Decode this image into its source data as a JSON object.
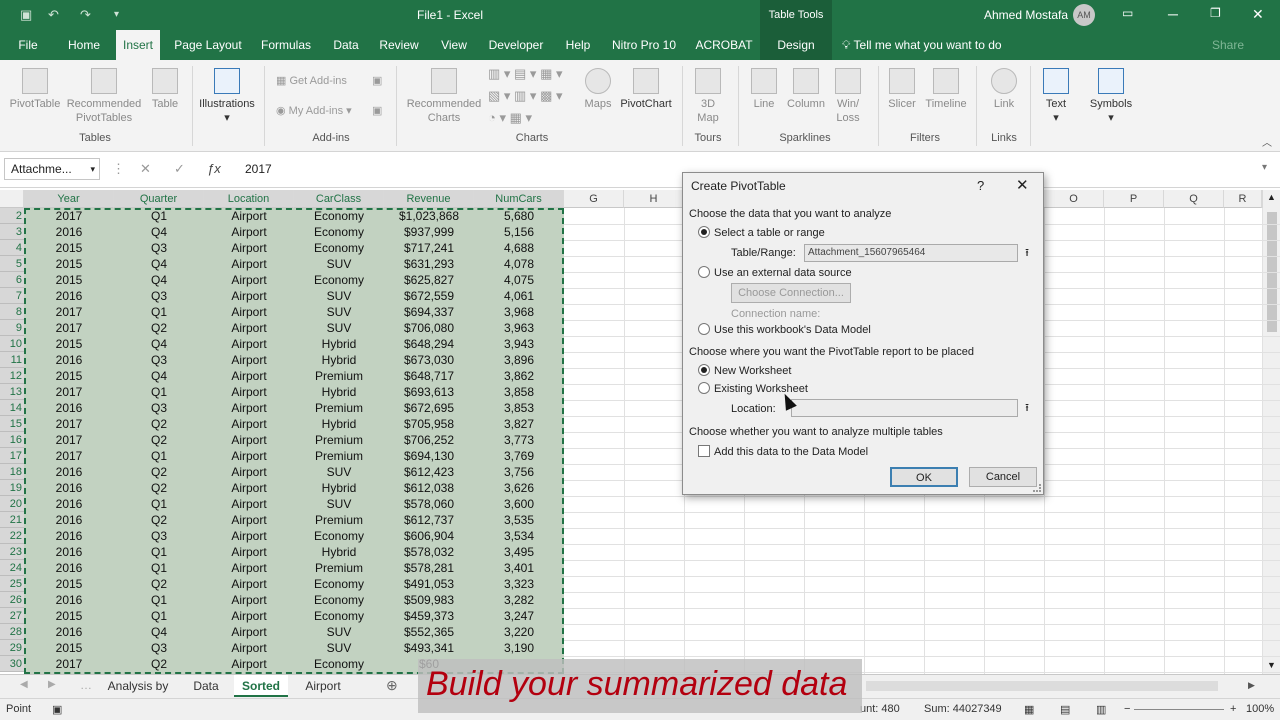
{
  "window": {
    "title": "File1 - Excel",
    "table_tools": "Table Tools",
    "user": "Ahmed Mostafa",
    "user_initials": "AM"
  },
  "menu": {
    "tabs": [
      "File",
      "Home",
      "Insert",
      "Page Layout",
      "Formulas",
      "Data",
      "Review",
      "View",
      "Developer",
      "Help",
      "Nitro Pro 10",
      "ACROBAT",
      "Design"
    ],
    "active": "Insert",
    "tell_me": "Tell me what you want to do",
    "share": "Share"
  },
  "ribbon": {
    "groups": [
      "Tables",
      "Add-ins",
      "Charts",
      "Tours",
      "Sparklines",
      "Filters",
      "Links"
    ],
    "buttons": {
      "pivot_table": "PivotTable",
      "recommended_pivot": "Recommended PivotTables",
      "table": "Table",
      "illustrations": "Illustrations",
      "get_addins": "Get Add-ins",
      "my_addins": "My Add-ins",
      "recommended_charts": "Recommended Charts",
      "maps": "Maps",
      "pivot_chart": "PivotChart",
      "map_3d": "3D Map",
      "line": "Line",
      "column": "Column",
      "win_loss": "Win/ Loss",
      "slicer": "Slicer",
      "timeline": "Timeline",
      "link": "Link",
      "text": "Text",
      "symbols": "Symbols"
    }
  },
  "formula_bar": {
    "name_box": "Attachme...",
    "value": "2017"
  },
  "grid": {
    "columns": [
      "Year",
      "Quarter",
      "Location",
      "CarClass",
      "Revenue",
      "NumCars",
      "G",
      "H",
      "I",
      "J",
      "K",
      "L",
      "M",
      "N",
      "O",
      "P",
      "Q",
      "R"
    ],
    "rows": [
      {
        "n": "2",
        "year": "2017",
        "quarter": "Q1",
        "location": "Airport",
        "carclass": "Economy",
        "revenue": "$1,023,868",
        "numcars": "5,680"
      },
      {
        "n": "3",
        "year": "2016",
        "quarter": "Q4",
        "location": "Airport",
        "carclass": "Economy",
        "revenue": "$937,999",
        "numcars": "5,156"
      },
      {
        "n": "4",
        "year": "2015",
        "quarter": "Q3",
        "location": "Airport",
        "carclass": "Economy",
        "revenue": "$717,241",
        "numcars": "4,688"
      },
      {
        "n": "5",
        "year": "2015",
        "quarter": "Q4",
        "location": "Airport",
        "carclass": "SUV",
        "revenue": "$631,293",
        "numcars": "4,078"
      },
      {
        "n": "6",
        "year": "2015",
        "quarter": "Q4",
        "location": "Airport",
        "carclass": "Economy",
        "revenue": "$625,827",
        "numcars": "4,075"
      },
      {
        "n": "7",
        "year": "2016",
        "quarter": "Q3",
        "location": "Airport",
        "carclass": "SUV",
        "revenue": "$672,559",
        "numcars": "4,061"
      },
      {
        "n": "8",
        "year": "2017",
        "quarter": "Q1",
        "location": "Airport",
        "carclass": "SUV",
        "revenue": "$694,337",
        "numcars": "3,968"
      },
      {
        "n": "9",
        "year": "2017",
        "quarter": "Q2",
        "location": "Airport",
        "carclass": "SUV",
        "revenue": "$706,080",
        "numcars": "3,963"
      },
      {
        "n": "10",
        "year": "2015",
        "quarter": "Q4",
        "location": "Airport",
        "carclass": "Hybrid",
        "revenue": "$648,294",
        "numcars": "3,943"
      },
      {
        "n": "11",
        "year": "2016",
        "quarter": "Q3",
        "location": "Airport",
        "carclass": "Hybrid",
        "revenue": "$673,030",
        "numcars": "3,896"
      },
      {
        "n": "12",
        "year": "2015",
        "quarter": "Q4",
        "location": "Airport",
        "carclass": "Premium",
        "revenue": "$648,717",
        "numcars": "3,862"
      },
      {
        "n": "13",
        "year": "2017",
        "quarter": "Q1",
        "location": "Airport",
        "carclass": "Hybrid",
        "revenue": "$693,613",
        "numcars": "3,858"
      },
      {
        "n": "14",
        "year": "2016",
        "quarter": "Q3",
        "location": "Airport",
        "carclass": "Premium",
        "revenue": "$672,695",
        "numcars": "3,853"
      },
      {
        "n": "15",
        "year": "2017",
        "quarter": "Q2",
        "location": "Airport",
        "carclass": "Hybrid",
        "revenue": "$705,958",
        "numcars": "3,827"
      },
      {
        "n": "16",
        "year": "2017",
        "quarter": "Q2",
        "location": "Airport",
        "carclass": "Premium",
        "revenue": "$706,252",
        "numcars": "3,773"
      },
      {
        "n": "17",
        "year": "2017",
        "quarter": "Q1",
        "location": "Airport",
        "carclass": "Premium",
        "revenue": "$694,130",
        "numcars": "3,769"
      },
      {
        "n": "18",
        "year": "2016",
        "quarter": "Q2",
        "location": "Airport",
        "carclass": "SUV",
        "revenue": "$612,423",
        "numcars": "3,756"
      },
      {
        "n": "19",
        "year": "2016",
        "quarter": "Q2",
        "location": "Airport",
        "carclass": "Hybrid",
        "revenue": "$612,038",
        "numcars": "3,626"
      },
      {
        "n": "20",
        "year": "2016",
        "quarter": "Q1",
        "location": "Airport",
        "carclass": "SUV",
        "revenue": "$578,060",
        "numcars": "3,600"
      },
      {
        "n": "21",
        "year": "2016",
        "quarter": "Q2",
        "location": "Airport",
        "carclass": "Premium",
        "revenue": "$612,737",
        "numcars": "3,535"
      },
      {
        "n": "22",
        "year": "2016",
        "quarter": "Q3",
        "location": "Airport",
        "carclass": "Economy",
        "revenue": "$606,904",
        "numcars": "3,534"
      },
      {
        "n": "23",
        "year": "2016",
        "quarter": "Q1",
        "location": "Airport",
        "carclass": "Hybrid",
        "revenue": "$578,032",
        "numcars": "3,495"
      },
      {
        "n": "24",
        "year": "2016",
        "quarter": "Q1",
        "location": "Airport",
        "carclass": "Premium",
        "revenue": "$578,281",
        "numcars": "3,401"
      },
      {
        "n": "25",
        "year": "2015",
        "quarter": "Q2",
        "location": "Airport",
        "carclass": "Economy",
        "revenue": "$491,053",
        "numcars": "3,323"
      },
      {
        "n": "26",
        "year": "2016",
        "quarter": "Q1",
        "location": "Airport",
        "carclass": "Economy",
        "revenue": "$509,983",
        "numcars": "3,282"
      },
      {
        "n": "27",
        "year": "2015",
        "quarter": "Q1",
        "location": "Airport",
        "carclass": "Economy",
        "revenue": "$459,373",
        "numcars": "3,247"
      },
      {
        "n": "28",
        "year": "2016",
        "quarter": "Q4",
        "location": "Airport",
        "carclass": "SUV",
        "revenue": "$552,365",
        "numcars": "3,220"
      },
      {
        "n": "29",
        "year": "2015",
        "quarter": "Q3",
        "location": "Airport",
        "carclass": "SUV",
        "revenue": "$493,341",
        "numcars": "3,190"
      },
      {
        "n": "30",
        "year": "2017",
        "quarter": "Q2",
        "location": "Airport",
        "carclass": "Economy",
        "revenue": "$60",
        "numcars": ""
      }
    ]
  },
  "sheets": {
    "tabs": [
      "Analysis by",
      "Data",
      "Sorted",
      "Airport"
    ],
    "active": "Sorted"
  },
  "status": {
    "mode": "Point",
    "count": "Count: 480",
    "count_visible": "unt: 480",
    "sum": "Sum: 44027349",
    "zoom": "100%"
  },
  "caption": "Build your summarized data",
  "dialog": {
    "title": "Create PivotTable",
    "help": "?",
    "section1": "Choose the data that you want to analyze",
    "opt_table": "Select a table or range",
    "table_range_label": "Table/Range:",
    "table_range_value": "Attachment_15607965464",
    "opt_external": "Use an external data source",
    "choose_connection": "Choose Connection...",
    "connection_name": "Connection name:",
    "opt_datamodel": "Use this workbook's Data Model",
    "section2": "Choose where you want the PivotTable report to be placed",
    "opt_new": "New Worksheet",
    "opt_existing": "Existing Worksheet",
    "location_label": "Location:",
    "section3": "Choose whether you want to analyze multiple tables",
    "add_datamodel": "Add this data to the Data Model",
    "ok": "OK",
    "cancel": "Cancel"
  },
  "colors": {
    "excel_green": "#217346",
    "selection_fill": "#c2d2c1",
    "caption_text": "#b3000f"
  }
}
